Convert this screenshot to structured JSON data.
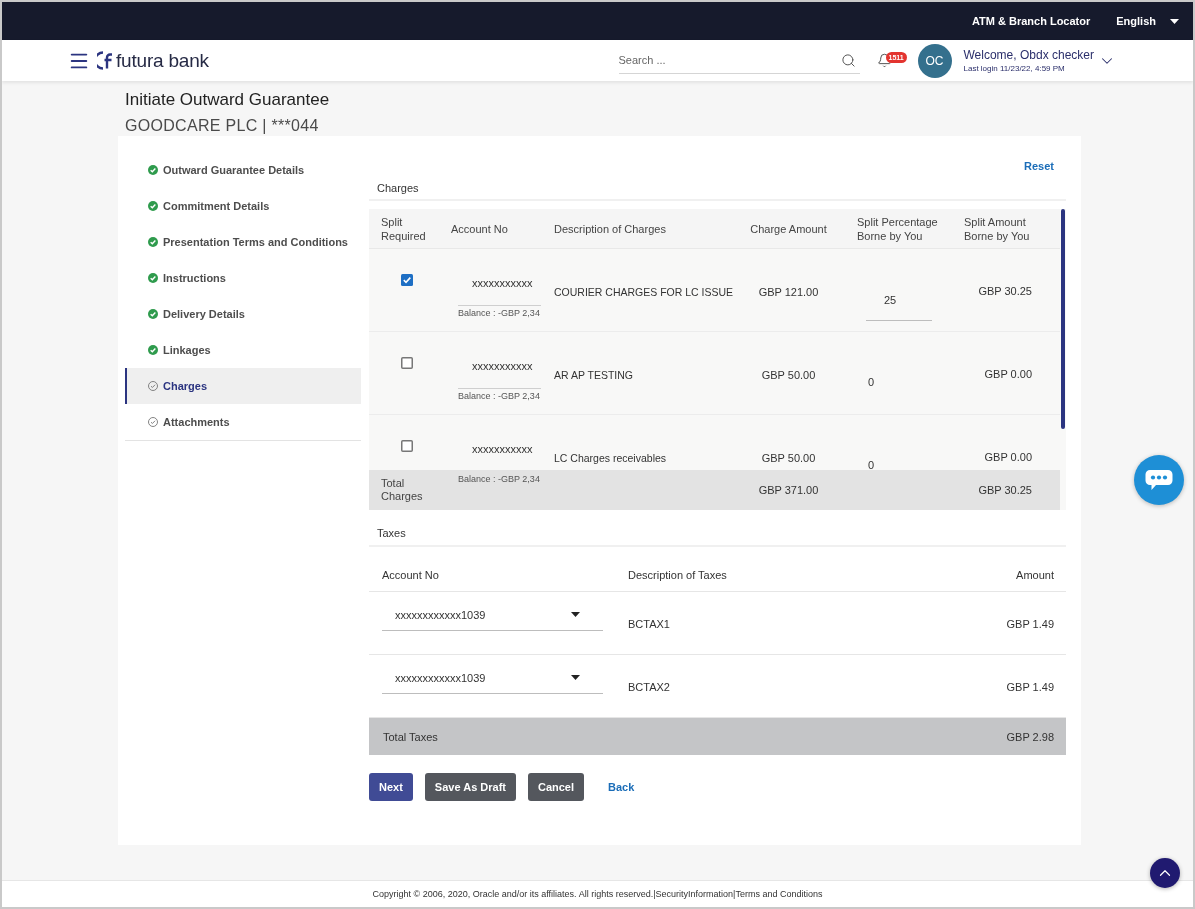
{
  "top_bar": {
    "locator_link": "ATM & Branch Locator",
    "language": "English"
  },
  "header": {
    "logo": "futura bank",
    "search": {
      "placeholder": "Search ..."
    },
    "notifications": "1511",
    "user": {
      "initials": "OC",
      "greeting": "Welcome, Obdx checker",
      "last_login": "Last login 11/23/22, 4:59 PM"
    }
  },
  "page": {
    "title": "Initiate Outward Guarantee",
    "subtitle": "GOODCARE PLC | ***044"
  },
  "steps": [
    {
      "label": "Outward Guarantee Details",
      "completed": true,
      "selected": false
    },
    {
      "label": "Commitment Details",
      "completed": true,
      "selected": false
    },
    {
      "label": "Presentation Terms and Conditions",
      "completed": true,
      "selected": false
    },
    {
      "label": "Instructions",
      "completed": true,
      "selected": false
    },
    {
      "label": "Delivery Details",
      "completed": true,
      "selected": false
    },
    {
      "label": "Linkages",
      "completed": true,
      "selected": false
    },
    {
      "label": "Charges",
      "completed": false,
      "selected": true
    },
    {
      "label": "Attachments",
      "completed": false,
      "selected": false
    }
  ],
  "reset": "Reset",
  "charges": {
    "title": "Charges",
    "columns": [
      "Split Required",
      "Account No",
      "Description of Charges",
      "Charge Amount",
      "Split Percentage Borne by You",
      "Split Amount Borne by You"
    ],
    "rows": [
      {
        "split_required": true,
        "account_no": "xxxxxxxxxxx",
        "balance": "Balance : -GBP 2,34",
        "description": "COURIER CHARGES FOR LC ISSUE",
        "charge_amount": "GBP 121.00",
        "split_percentage": "25",
        "split_amount": "GBP 30.25"
      },
      {
        "split_required": false,
        "account_no": "xxxxxxxxxxx",
        "balance": "Balance : -GBP 2,34",
        "description": "AR AP TESTING",
        "charge_amount": "GBP 50.00",
        "split_percentage": "0",
        "split_amount": "GBP 0.00"
      },
      {
        "split_required": false,
        "account_no": "xxxxxxxxxxx",
        "balance": "Balance : -GBP 2,34",
        "description": "LC Charges receivables",
        "charge_amount": "GBP 50.00",
        "split_percentage": "0",
        "split_amount": "GBP 0.00"
      }
    ],
    "total": {
      "label": "Total Charges",
      "charge_amount": "GBP 371.00",
      "split_amount": "GBP 30.25"
    }
  },
  "taxes": {
    "title": "Taxes",
    "columns": [
      "Account No",
      "Description of Taxes",
      "Amount"
    ],
    "rows": [
      {
        "account_no": "xxxxxxxxxxxx1039",
        "description": "BCTAX1",
        "amount": "GBP 1.49"
      },
      {
        "account_no": "xxxxxxxxxxxx1039",
        "description": "BCTAX2",
        "amount": "GBP 1.49"
      }
    ],
    "total": {
      "label": "Total Taxes",
      "amount": "GBP 2.98"
    }
  },
  "actions": [
    {
      "label": "Next",
      "kind": "primary"
    },
    {
      "label": "Save As Draft",
      "kind": "secondary"
    },
    {
      "label": "Cancel",
      "kind": "secondary"
    },
    {
      "label": "Back",
      "kind": "link"
    }
  ],
  "footer": {
    "copyright": "Copyright © 2006, 2020, Oracle and/or its affiliates. All rights reserved.",
    "separator": "|",
    "links": [
      "SecurityInformation",
      "Terms and Conditions"
    ]
  }
}
